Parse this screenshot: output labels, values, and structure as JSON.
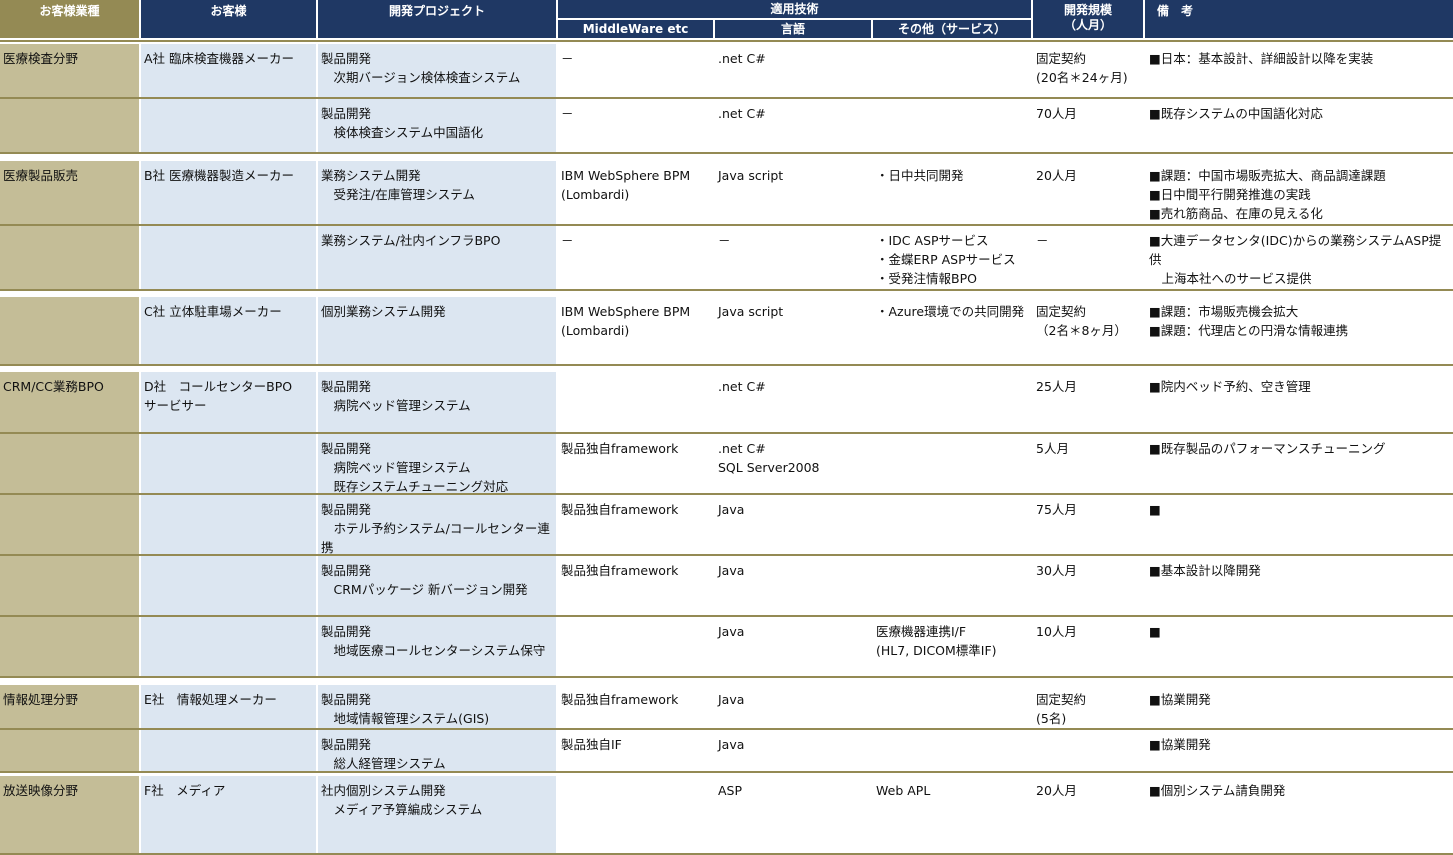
{
  "headers": {
    "industry": "お客様業種",
    "customer": "お客様",
    "project": "開発プロジェクト",
    "tech": "適用技術",
    "middleware": "MiddleWare etc",
    "language": "言語",
    "other": "その他（サービス）",
    "scale": "開発規模\n（人月）",
    "notes": "備　考"
  },
  "rows": [
    {
      "industry": "医療検査分野",
      "customer": "A社 臨床検査機器メーカー",
      "project": "製品開発\n　次期バージョン検体検査システム",
      "middleware": "－",
      "language": ".net C#",
      "other": "",
      "scale": "固定契約\n(20名＊24ヶ月)",
      "notes": "■日本：基本設計、詳細設計以降を実装"
    },
    {
      "industry": "",
      "customer": "",
      "project": "製品開発\n　検体検査システム中国語化",
      "middleware": "－",
      "language": ".net C#",
      "other": "",
      "scale": "70人月",
      "notes": "■既存システムの中国語化対応"
    },
    {
      "industry": "医療製品販売",
      "customer": "B社 医療機器製造メーカー",
      "project": "業務システム開発\n　受発注/在庫管理システム",
      "middleware": "IBM WebSphere BPM\n(Lombardi)",
      "language": "Java script",
      "other": "・日中共同開発",
      "scale": "20人月",
      "notes": "■課題：中国市場販売拡大、商品調達課題\n■日中間平行開発推進の実践\n■売れ筋商品、在庫の見える化"
    },
    {
      "industry": "",
      "customer": "",
      "project": "業務システム/社内インフラBPO",
      "middleware": "－",
      "language": "－",
      "other": "・IDC ASPサービス\n・金蝶ERP ASPサービス\n・受発注情報BPO",
      "scale": "－",
      "notes": "■大連データセンタ(IDC)からの業務システムASP提供\n　上海本社へのサービス提供"
    },
    {
      "industry": "",
      "customer": "C社 立体駐車場メーカー",
      "project": "個別業務システム開発",
      "middleware": "IBM WebSphere BPM\n(Lombardi)",
      "language": "Java script",
      "other": "・Azure環境での共同開発",
      "scale": "固定契約\n（2名＊8ヶ月）",
      "notes": "■課題：市場販売機会拡大\n■課題：代理店との円滑な情報連携"
    },
    {
      "industry": "CRM/CC業務BPO",
      "customer": "D社　コールセンターBPO\nサービサー",
      "project": "製品開発\n　病院ベッド管理システム",
      "middleware": "",
      "language": ".net C#",
      "other": "",
      "scale": "25人月",
      "notes": "■院内ベッド予約、空き管理"
    },
    {
      "industry": "",
      "customer": "",
      "project": "製品開発\n　病院ベッド管理システム\n　既存システムチューニング対応",
      "middleware": "製品独自framework",
      "language": ".net C#\nSQL Server2008",
      "other": "",
      "scale": "5人月",
      "notes": "■既存製品のパフォーマンスチューニング"
    },
    {
      "industry": "",
      "customer": "",
      "project": "製品開発\n　ホテル予約システム/コールセンター連携",
      "middleware": "製品独自framework",
      "language": "Java",
      "other": "",
      "scale": "75人月",
      "notes": "■"
    },
    {
      "industry": "",
      "customer": "",
      "project": "製品開発\n　CRMパッケージ 新バージョン開発",
      "middleware": "製品独自framework",
      "language": "Java",
      "other": "",
      "scale": "30人月",
      "notes": "■基本設計以降開発"
    },
    {
      "industry": "",
      "customer": "",
      "project": "製品開発\n　地域医療コールセンターシステム保守",
      "middleware": "",
      "language": "Java",
      "other": "医療機器連携I/F\n(HL7, DICOM標準IF)",
      "scale": "10人月",
      "notes": "■"
    },
    {
      "industry": "情報処理分野",
      "customer": "E社　情報処理メーカー",
      "project": "製品開発\n　地域情報管理システム(GIS)",
      "middleware": "製品独自framework",
      "language": "Java",
      "other": "",
      "scale": "固定契約\n(5名)",
      "notes": "■協業開発"
    },
    {
      "industry": "",
      "customer": "",
      "project": "製品開発\n　総人経管理システム",
      "middleware": "製品独自IF",
      "language": "Java",
      "other": "",
      "scale": "",
      "notes": "■協業開発"
    },
    {
      "industry": "放送映像分野",
      "customer": "F社　メディア",
      "project": "社内個別システム開発\n　メディア予算編成システム",
      "middleware": "",
      "language": "ASP",
      "other": "Web APL",
      "scale": "20人月",
      "notes": "■個別システム請負開発"
    }
  ]
}
